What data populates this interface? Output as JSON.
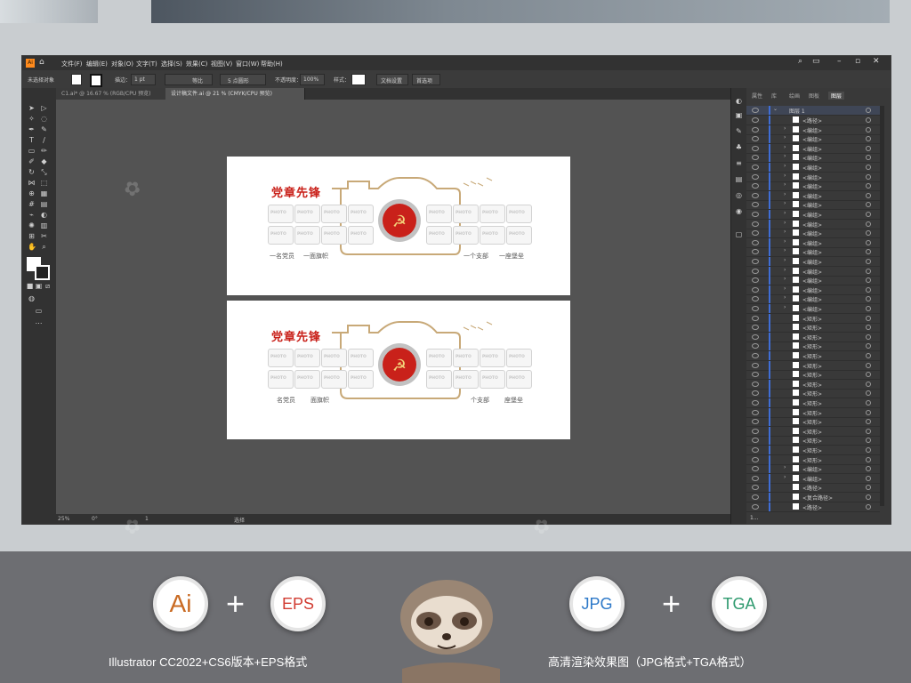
{
  "app": {
    "badge": "Ai",
    "menu": [
      "文件(F)",
      "编辑(E)",
      "对象(O)",
      "文字(T)",
      "选择(S)",
      "效果(C)",
      "视图(V)",
      "窗口(W)",
      "帮助(H)"
    ]
  },
  "control_bar": {
    "selection": "未选择对象",
    "stroke_label": "描边：",
    "stroke_value": "1 pt",
    "stroke_style": "等比",
    "brush": "5 点圆形",
    "opacity_label": "不透明度：",
    "opacity_value": "100%",
    "style_label": "样式：",
    "doc_setup": "文档设置",
    "prefs": "首选项"
  },
  "doc_tabs": [
    {
      "label": "C1.ai* @ 16.67 % (RGB/CPU 预览)"
    },
    {
      "label": "设计稿文件.ai @ 21 % (CMYK/CPU 预览)"
    }
  ],
  "status": {
    "zoom": "25%",
    "rotation": "0°",
    "page": "1",
    "tool": "选择"
  },
  "panel": {
    "tabs": [
      "属性",
      "库",
      "绘画",
      "图板",
      "图层"
    ],
    "layer_name": "图层 1",
    "rows": [
      "<路径>",
      "<编组>",
      "<编组>",
      "<编组>",
      "<编组>",
      "<编组>",
      "<编组>",
      "<编组>",
      "<编组>",
      "<编组>",
      "<编组>",
      "<编组>",
      "<编组>",
      "<编组>",
      "<编组>",
      "<编组>",
      "<编组>",
      "<编组>",
      "<编组>",
      "<编组>",
      "<编组>",
      "<矩形>",
      "<矩形>",
      "<矩形>",
      "<矩形>",
      "<矩形>",
      "<矩形>",
      "<矩形>",
      "<矩形>",
      "<矩形>",
      "<矩形>",
      "<矩形>",
      "<矩形>",
      "<矩形>",
      "<矩形>",
      "<矩形>",
      "<矩形>",
      "<编组>",
      "<编组>",
      "<路径>",
      "<复合路径>",
      "<路径>"
    ],
    "footer": "1..."
  },
  "artwork": {
    "title": "党章先锋",
    "photo_label": "PHOTO",
    "slogans_1": [
      "一名党员",
      "一面旗帜",
      "一个支部",
      "一座堡垒"
    ],
    "slogans_2": [
      "名党员",
      "面旗帜",
      "个支部",
      "座堡垒"
    ]
  },
  "banner": {
    "badge_ai": "Ai",
    "badge_eps": "EPS",
    "badge_jpg": "JPG",
    "badge_tga": "TGA",
    "plus": "+",
    "caption_left": "Illustrator CC2022+CS6版本+EPS格式",
    "caption_right": "高清渲染效果图（JPG格式+TGA格式）"
  },
  "colors": {
    "party_red": "#c9211a",
    "camera_gold": "#c8a978",
    "ai_orange": "#c96a22",
    "eps_red": "#d13b31",
    "jpg_blue": "#2c78c8",
    "tga_green": "#2e9a6e"
  }
}
